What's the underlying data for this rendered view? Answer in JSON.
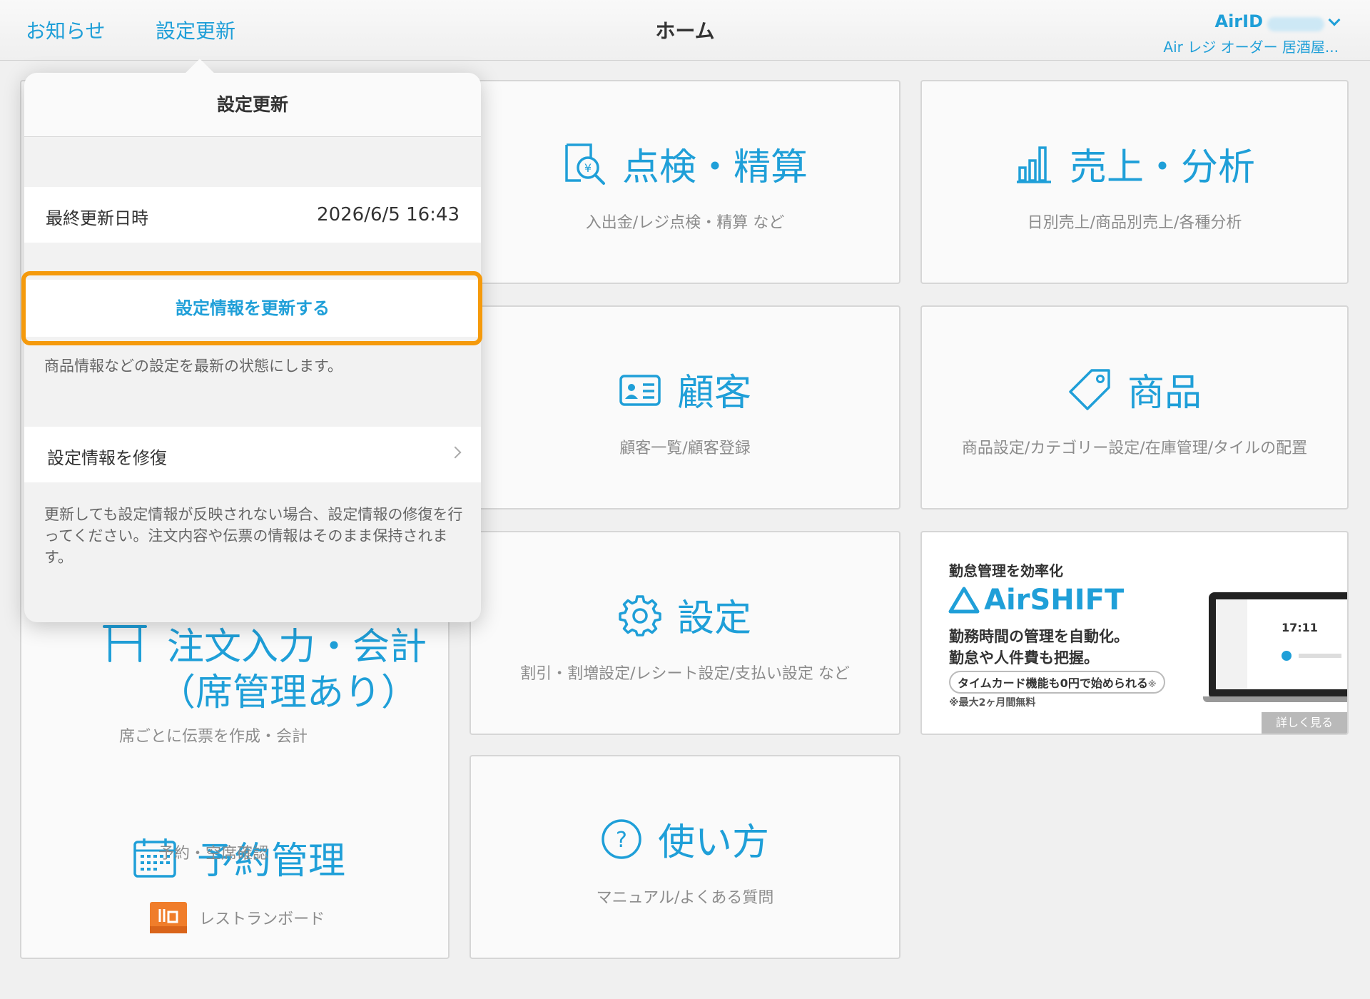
{
  "header": {
    "notice_label": "お知らせ",
    "settings_update_label": "設定更新",
    "title": "ホーム",
    "airid_label": "AirID",
    "shop_label": "Air レジ オーダー 居酒屋..."
  },
  "popover": {
    "title": "設定更新",
    "last_update_label": "最終更新日時",
    "last_update_value": "2026/6/5 16:43",
    "update_button": "設定情報を更新する",
    "update_note": "商品情報などの設定を最新の状態にします。",
    "repair_label": "設定情報を修復",
    "repair_note": "更新しても設定情報が反映されない場合、設定情報の修復を行ってください。注文内容や伝票の情報はそのまま保持されます。",
    "highlight_color": "#f59a0c"
  },
  "tiles": {
    "order_title_1": "注文入力・会計",
    "order_title_2": "（席管理あり）",
    "order_sub": "席ごとに伝票を作成・会計",
    "reservation_title": "予約管理",
    "reservation_sub": "予約・空席確認",
    "restaurant_board": "レストランボード",
    "inspection_title": "点検・精算",
    "inspection_sub": "入出金/レジ点検・精算 など",
    "sales_title": "売上・分析",
    "sales_sub": "日別売上/商品別売上/各種分析",
    "customer_title": "顧客",
    "customer_sub": "顧客一覧/顧客登録",
    "product_title": "商品",
    "product_sub": "商品設定/カテゴリー設定/在庫管理/タイルの配置",
    "settings_title": "設定",
    "settings_sub": "割引・割増設定/レシート設定/支払い設定 など",
    "help_title": "使い方",
    "help_sub": "マニュアル/よくある質問"
  },
  "ad": {
    "headline": "勤怠管理を効率化",
    "brand": "AirSHIFT",
    "line1": "勤務時間の管理を自動化。",
    "line2": "勤怠や人件費も把握。",
    "pill": "タイムカード機能も0円で始められる",
    "pill_mark": "※",
    "note": "※最大2ヶ月間無料",
    "screen_time": "17:11",
    "more_button": "詳しく見る"
  },
  "colors": {
    "accent": "#1f9fd8",
    "highlight": "#f59a0c",
    "restaurant_board": "#f07d2a"
  }
}
